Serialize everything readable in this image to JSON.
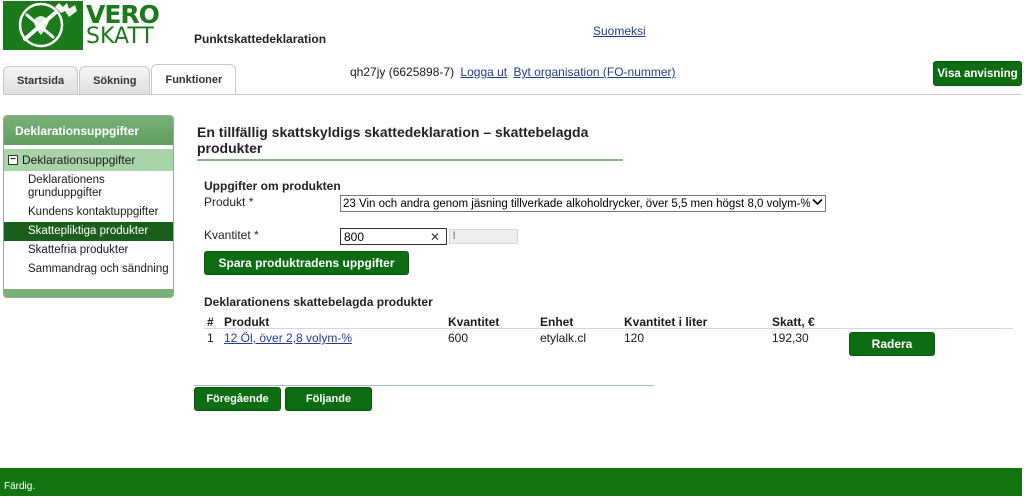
{
  "logo": {
    "line1": "VERO",
    "line2": "SKATT",
    "accent": "#1b7a1b"
  },
  "header": {
    "app_title": "Punktskattedeklaration",
    "lang_link": "Suomeksi",
    "user_id": "qh27jy (6625898-7)",
    "logout_link": "Logga ut",
    "switch_org_link": "Byt organisation (FO-nummer)",
    "help_button": "Visa anvisning"
  },
  "tabs": [
    {
      "label": "Startsida"
    },
    {
      "label": "Sökning"
    },
    {
      "label": "Funktioner",
      "active": true
    }
  ],
  "sidebar": {
    "header": "Deklarationsuppgifter",
    "section": "Deklarationsuppgifter",
    "items": [
      {
        "label": "Deklarationens grunduppgifter"
      },
      {
        "label": "Kundens kontaktuppgifter"
      },
      {
        "label": "Skattepliktiga produkter",
        "active": true
      },
      {
        "label": "Skattefria produkter"
      },
      {
        "label": "Sammandrag och sändning"
      }
    ]
  },
  "main": {
    "title": "En tillfällig skattskyldigs skattedeklaration – skattebelagda produkter",
    "product_section": "Uppgifter om produkten",
    "product_label": "Produkt *",
    "product_selected": "23 Vin och andra genom jäsning tillverkade alkoholdrycker, över 5,5 men högst 8,0 volym-%",
    "quantity_label": "Kvantitet *",
    "quantity_value": "800",
    "unit_value": "l",
    "save_button": "Spara produktradens uppgifter",
    "table_section": "Deklarationens skattebelagda produkter",
    "columns": [
      "#",
      "Produkt",
      "Kvantitet",
      "Enhet",
      "Kvantitet i liter",
      "Skatt, €"
    ],
    "rows": [
      {
        "num": "1",
        "product": "12 Öl, över 2,8 volym-%",
        "quantity": "600",
        "unit": "etylalk.cl",
        "liters": "120",
        "tax": "192,30",
        "delete_label": "Radera"
      }
    ],
    "prev_button": "Föregående",
    "next_button": "Följande"
  },
  "status": {
    "text": "Färdig."
  },
  "colors": {
    "primary_green": "#0e6d12",
    "sidebar_header": "#6aa66a",
    "sidebar_section": "#a9d4a9",
    "active_item": "#1b5e1b",
    "link": "#1f3f8f"
  }
}
